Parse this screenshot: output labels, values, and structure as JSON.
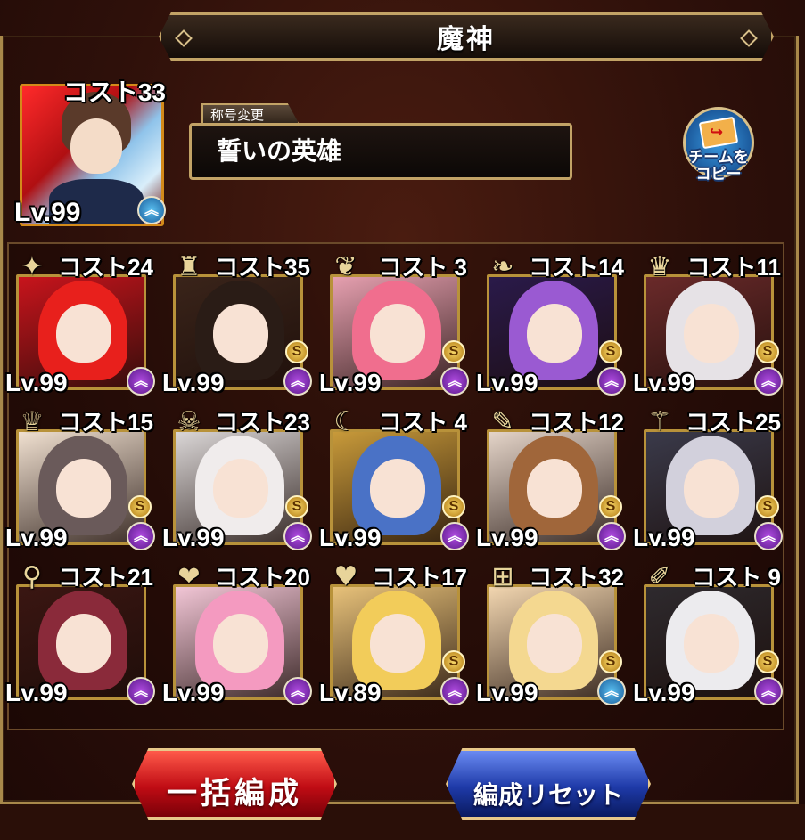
{
  "header": {
    "title": "魔神"
  },
  "leader": {
    "cost": "コスト33",
    "level": "Lv.99",
    "rank_color": "#2a8fd0",
    "rank_icon": "double-chevron-up-icon"
  },
  "title_section": {
    "tab_label": "称号変更",
    "title": "誓いの英雄"
  },
  "copy_button": {
    "label_line1": "チームを",
    "label_line2": "コピー"
  },
  "units": [
    {
      "cost": "コスト24",
      "level": "Lv.99",
      "s_badge": false,
      "rank": "purple",
      "bg": "#c8141c",
      "hair": "#e8201c",
      "emblem": "✦"
    },
    {
      "cost": "コスト35",
      "level": "Lv.99",
      "s_badge": true,
      "rank": "purple",
      "bg": "#3a241a",
      "hair": "#2a1c16",
      "emblem": "♜"
    },
    {
      "cost": "コスト 3",
      "level": "Lv.99",
      "s_badge": true,
      "rank": "purple",
      "bg": "#e6a0b0",
      "hair": "#f06e8e",
      "emblem": "❦"
    },
    {
      "cost": "コスト14",
      "level": "Lv.99",
      "s_badge": true,
      "rank": "purple",
      "bg": "#2a1a4a",
      "hair": "#9a5ad2",
      "emblem": "❧"
    },
    {
      "cost": "コスト11",
      "level": "Lv.99",
      "s_badge": true,
      "rank": "purple",
      "bg": "#6a2a2a",
      "hair": "#e6e2e6",
      "emblem": "♛"
    },
    {
      "cost": "コスト15",
      "level": "Lv.99",
      "s_badge": true,
      "rank": "purple",
      "bg": "#f0e0d0",
      "hair": "#6a5a5a",
      "emblem": "♕"
    },
    {
      "cost": "コスト23",
      "level": "Lv.99",
      "s_badge": true,
      "rank": "purple",
      "bg": "#dad6d6",
      "hair": "#f0ecec",
      "emblem": "☠"
    },
    {
      "cost": "コスト 4",
      "level": "Lv.99",
      "s_badge": true,
      "rank": "purple",
      "bg": "#c89a3a",
      "hair": "#4a72c6",
      "emblem": "☾"
    },
    {
      "cost": "コスト12",
      "level": "Lv.99",
      "s_badge": true,
      "rank": "purple",
      "bg": "#e4d4c8",
      "hair": "#a0663a",
      "emblem": "✎"
    },
    {
      "cost": "コスト25",
      "level": "Lv.99",
      "s_badge": true,
      "rank": "purple",
      "bg": "#3a3a4a",
      "hair": "#d2d0dc",
      "emblem": "⚚"
    },
    {
      "cost": "コスト21",
      "level": "Lv.99",
      "s_badge": false,
      "rank": "purple",
      "bg": "#3a1612",
      "hair": "#8a2a3a",
      "emblem": "⚲"
    },
    {
      "cost": "コスト20",
      "level": "Lv.99",
      "s_badge": false,
      "rank": "purple",
      "bg": "#f2c6d6",
      "hair": "#f49ac0",
      "emblem": "❤"
    },
    {
      "cost": "コスト17",
      "level": "Lv.89",
      "s_badge": true,
      "rank": "purple",
      "bg": "#e8c27a",
      "hair": "#f2cc5a",
      "emblem": "♥"
    },
    {
      "cost": "コスト32",
      "level": "Lv.99",
      "s_badge": true,
      "rank": "blue",
      "bg": "#f2d6b0",
      "hair": "#f4d890",
      "emblem": "⊞"
    },
    {
      "cost": "コスト 9",
      "level": "Lv.99",
      "s_badge": true,
      "rank": "purple",
      "bg": "#2e2a2e",
      "hair": "#ecebee",
      "emblem": "✐"
    }
  ],
  "footer": {
    "bulk_label": "一括編成",
    "reset_label": "編成リセット"
  }
}
